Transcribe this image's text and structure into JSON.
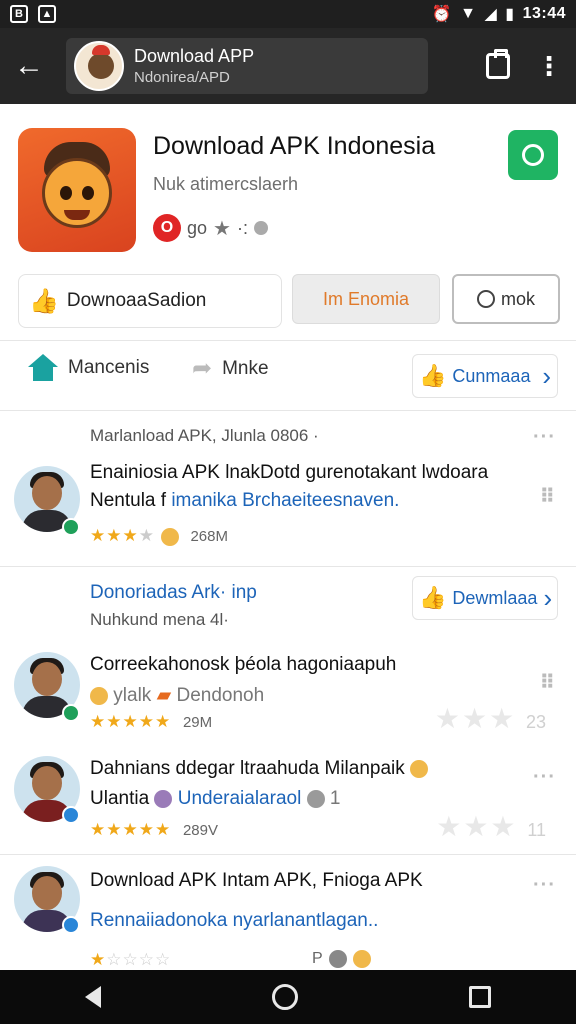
{
  "status_bar": {
    "time": "13:44"
  },
  "appbar": {
    "title": "Download APP",
    "subtitle": "Ndonirea/APD"
  },
  "app": {
    "title": "Download APK Indonesia",
    "subtitle": "Nuk atimercslaerh",
    "meta_badge": "O",
    "meta_text": "go",
    "meta_extra": "·:"
  },
  "actions": {
    "left_label": "DownoaaSadion",
    "mid_label": "Im Enomia",
    "right_label": "mok"
  },
  "nav": {
    "home_label": "Mancenis",
    "share_label": "Mnke",
    "cta_label": "Cunmaaa"
  },
  "posts": [
    {
      "header": "Marlanload APK, Jlunla 0806 ·",
      "line1": "Enainiosia APK lnakDotd gurenotakant lwdoara",
      "line2_plain": "Nentula f",
      "line2_link": "imanika Brchaeiteesnaven.",
      "stars_on": "★★★",
      "stars_off": "★",
      "count": "268M"
    },
    {
      "header_link": "Donoriadas Ark· inp",
      "header_sub": "Nuhkund mena 4l·",
      "cta": "Dewmlaaa"
    },
    {
      "line1": "Correekahonosk þéola hagoniaapuh",
      "line2": "ylalk",
      "line2b": "Dendonoh",
      "stars_on": "★★★★★",
      "count": "29M",
      "ghost": "23"
    },
    {
      "line1": "Dahnians ddegar ltraahuda Milanpaik",
      "line2_plain": "Ulantia",
      "line2_link": "Underaialaraol",
      "line2_tail": "1",
      "stars_on": "★★★★★",
      "count": "289V",
      "ghost": "11"
    },
    {
      "line1": "Download APK Intam APK, Fnioga APK",
      "line2_link": "Rennaiiadonoka nyarlanantlagan..",
      "stars_on": "★",
      "stars_off": "☆☆☆☆",
      "tail": "P"
    }
  ]
}
